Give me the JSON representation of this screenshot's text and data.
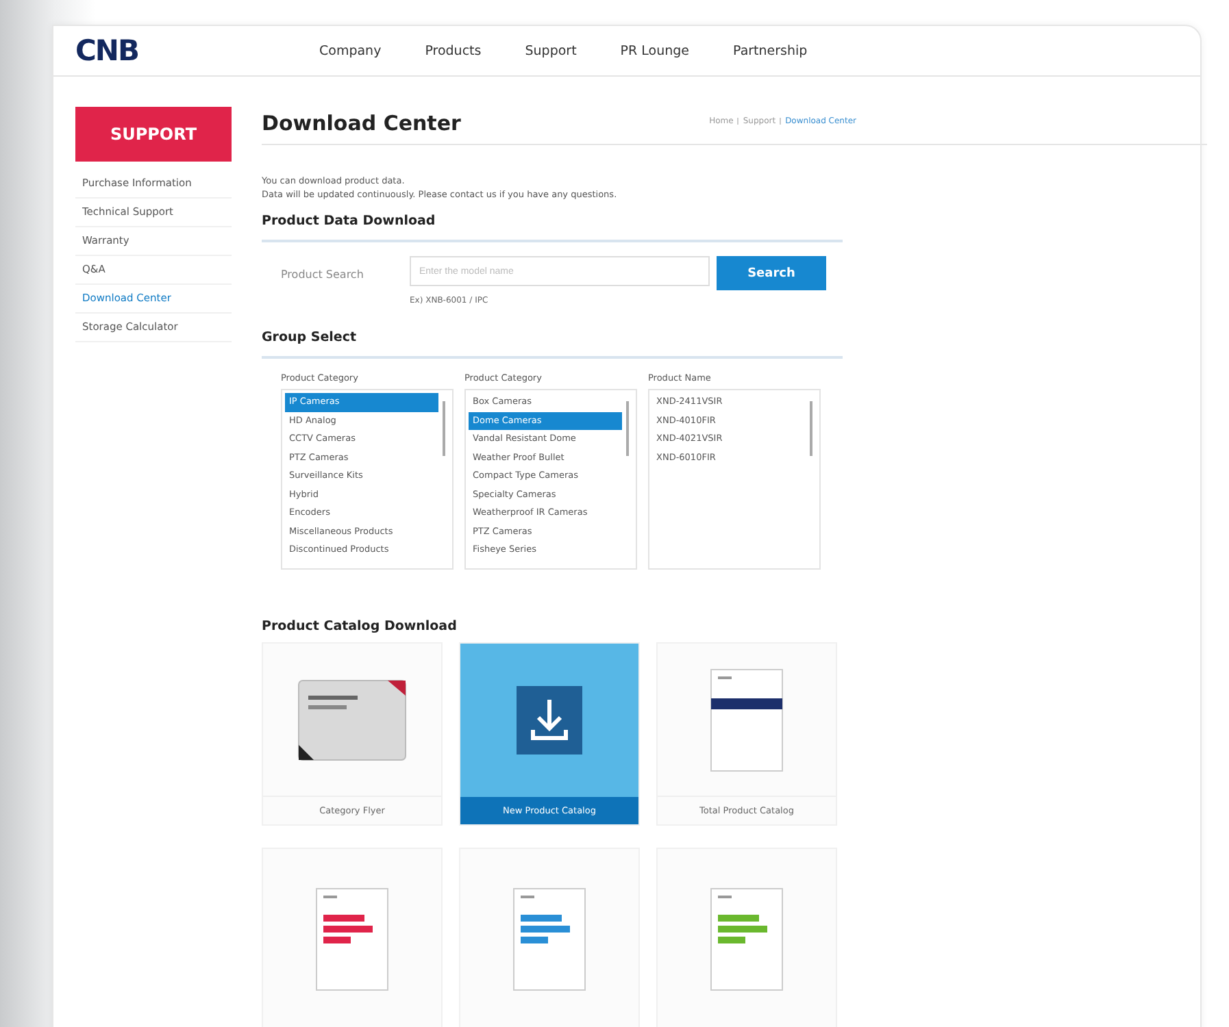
{
  "header": {
    "logo": "CNB",
    "nav": [
      "Company",
      "Products",
      "Support",
      "PR Lounge",
      "Partnership"
    ]
  },
  "sidebar": {
    "title": "SUPPORT",
    "items": [
      {
        "label": "Purchase Information",
        "selected": false
      },
      {
        "label": "Technical Support",
        "selected": false
      },
      {
        "label": "Warranty",
        "selected": false
      },
      {
        "label": "Q&A",
        "selected": false
      },
      {
        "label": "Download Center",
        "selected": true
      },
      {
        "label": "Storage Calculator",
        "selected": false
      }
    ]
  },
  "page": {
    "title": "Download Center",
    "breadcrumb": [
      "Home",
      "Support",
      "Download Center"
    ]
  },
  "notice": [
    "You can download product data.",
    "Data will be updated continuously. Please contact us if you have any questions."
  ],
  "data_download": {
    "heading": "Product Data Download",
    "label": "Product Search",
    "placeholder": "Enter the model name",
    "button": "Search",
    "hint": "Ex) XNB-6001 / IPC"
  },
  "group_select": {
    "heading": "Group Select",
    "lists": [
      {
        "label": "Product Category",
        "items": [
          {
            "text": "IP Cameras",
            "selected": true
          },
          {
            "text": "HD Analog",
            "selected": false
          },
          {
            "text": "CCTV Cameras",
            "selected": false
          },
          {
            "text": "PTZ Cameras",
            "selected": false
          },
          {
            "text": "Surveillance Kits",
            "selected": false
          },
          {
            "text": "Hybrid",
            "selected": false
          },
          {
            "text": "Encoders",
            "selected": false
          },
          {
            "text": "Miscellaneous Products",
            "selected": false
          },
          {
            "text": "Discontinued Products",
            "selected": false
          }
        ]
      },
      {
        "label": "Product Category",
        "items": [
          {
            "text": "Box Cameras",
            "selected": false
          },
          {
            "text": "Dome Cameras",
            "selected": true
          },
          {
            "text": "Vandal Resistant Dome",
            "selected": false
          },
          {
            "text": "Weather Proof Bullet",
            "selected": false
          },
          {
            "text": "Compact Type Cameras",
            "selected": false
          },
          {
            "text": "Specialty Cameras",
            "selected": false
          },
          {
            "text": "Weatherproof IR Cameras",
            "selected": false
          },
          {
            "text": "PTZ Cameras",
            "selected": false
          },
          {
            "text": "Fisheye Series",
            "selected": false
          }
        ]
      },
      {
        "label": "Product Name",
        "items": [
          {
            "text": "XND-2411VSIR",
            "selected": false
          },
          {
            "text": "XND-4010FIR",
            "selected": false
          },
          {
            "text": "XND-4021VSIR",
            "selected": false
          },
          {
            "text": "XND-6010FIR",
            "selected": false
          }
        ]
      }
    ]
  },
  "catalog": {
    "heading": "Product Catalog Download",
    "cards": [
      {
        "kind": "flyer",
        "label": "Category Flyer",
        "selected": false
      },
      {
        "kind": "download",
        "label": "New Product Catalog",
        "selected": true
      },
      {
        "kind": "book",
        "label": "Total Product Catalog",
        "selected": false,
        "color": "#1c2f6b"
      },
      {
        "kind": "cover",
        "selected": false,
        "color": "#e0244a"
      },
      {
        "kind": "cover",
        "selected": false,
        "color": "#2a8fd6"
      },
      {
        "kind": "cover",
        "selected": false,
        "color": "#6ab82e"
      }
    ]
  }
}
